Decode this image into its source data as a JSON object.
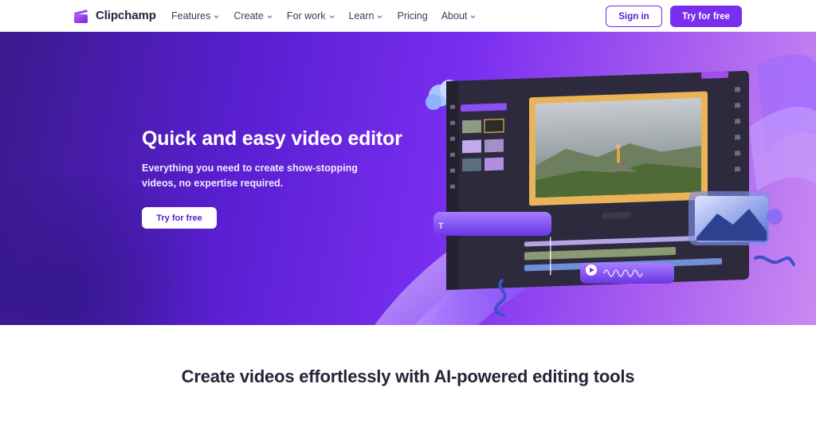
{
  "nav": {
    "brand": "Clipchamp",
    "items": [
      {
        "label": "Features",
        "has_dropdown": true
      },
      {
        "label": "Create",
        "has_dropdown": true
      },
      {
        "label": "For work",
        "has_dropdown": true
      },
      {
        "label": "Learn",
        "has_dropdown": true
      },
      {
        "label": "Pricing",
        "has_dropdown": false
      },
      {
        "label": "About",
        "has_dropdown": true
      }
    ],
    "sign_in": "Sign in",
    "try_free": "Try for free"
  },
  "hero": {
    "title": "Quick and easy video editor",
    "subtitle": "Everything you need to create show-stopping videos, no expertise required.",
    "cta": "Try for free"
  },
  "section": {
    "title": "Create videos effortlessly with AI-powered editing tools"
  },
  "colors": {
    "accent": "#7a2ff0",
    "brand_text": "#5b1fc7"
  }
}
